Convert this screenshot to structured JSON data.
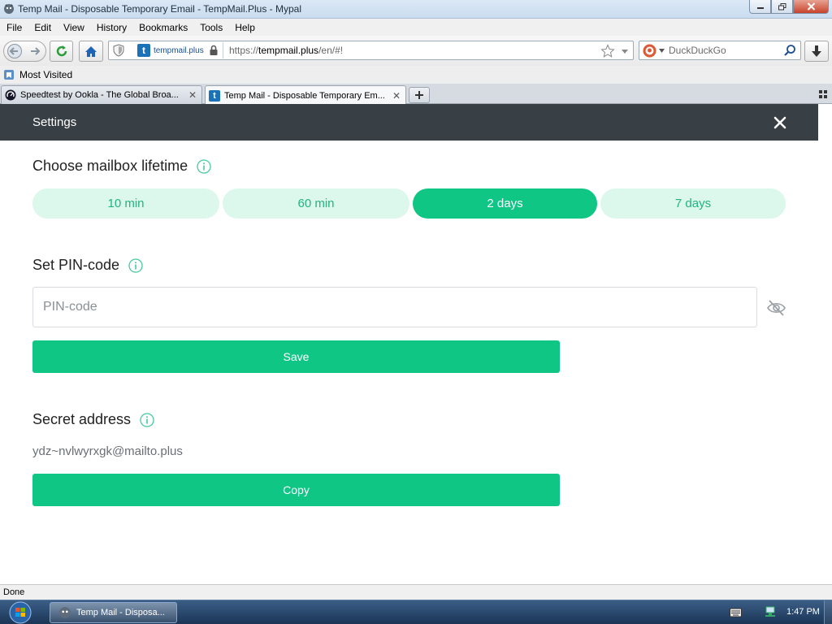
{
  "window": {
    "title": "Temp Mail - Disposable Temporary Email - TempMail.Plus - Mypal"
  },
  "menubar": {
    "items": [
      {
        "label": "File"
      },
      {
        "label": "Edit"
      },
      {
        "label": "View"
      },
      {
        "label": "History"
      },
      {
        "label": "Bookmarks"
      },
      {
        "label": "Tools"
      },
      {
        "label": "Help"
      }
    ]
  },
  "navbar": {
    "identity_domain": "tempmail.plus",
    "url_scheme": "https://",
    "url_host": "tempmail.plus",
    "url_path": "/en/#!",
    "search_placeholder": "DuckDuckGo"
  },
  "bookmarks": {
    "items": [
      {
        "label": "Most Visited",
        "icon": "bookmark-folder-icon"
      }
    ]
  },
  "tabs": [
    {
      "label": "Speedtest by Ookla - The Global Broa...",
      "icon": "speedtest-icon",
      "active": false
    },
    {
      "label": "Temp Mail - Disposable Temporary Em...",
      "icon": "tempmail-favicon",
      "active": true
    }
  ],
  "settings": {
    "heading": "Settings",
    "lifetime": {
      "title": "Choose mailbox lifetime",
      "options": [
        "10 min",
        "60 min",
        "2 days",
        "7 days"
      ],
      "selected": "2 days"
    },
    "pin": {
      "title": "Set PIN-code",
      "placeholder": "PIN-code",
      "value": "",
      "save_label": "Save"
    },
    "secret": {
      "title": "Secret address",
      "address": "ydz~nvlwyrxgk@mailto.plus",
      "copy_label": "Copy"
    }
  },
  "statusbar": {
    "text": "Done"
  },
  "taskbar": {
    "task_label": "Temp Mail - Disposa...",
    "clock": "1:47 PM"
  },
  "colors": {
    "accent": "#0fc685",
    "accent_light": "#dcf7ec",
    "header_bg": "#383f45"
  }
}
